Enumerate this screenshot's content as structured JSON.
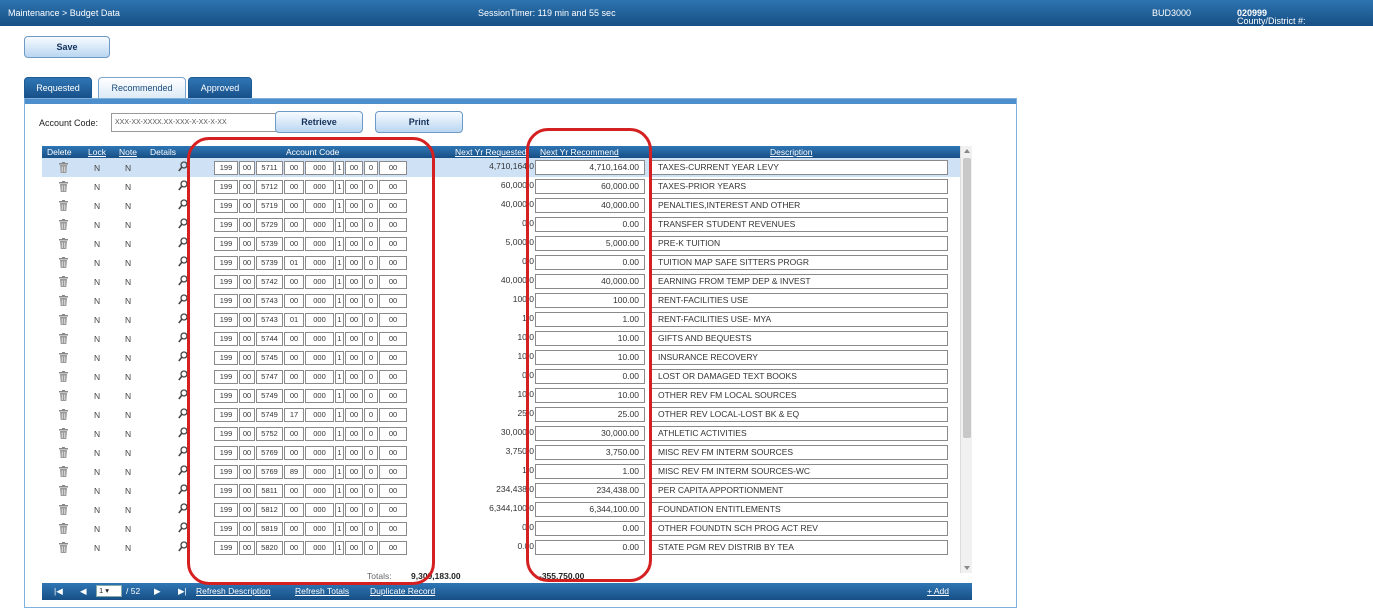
{
  "topbar": {
    "breadcrumb": "Maintenance > Budget Data",
    "session_timer": "SessionTimer: 119 min and 55 sec",
    "page_code": "BUD3000",
    "county_label": "County/District #:",
    "county_value": "020999"
  },
  "toolbar": {
    "save_label": "Save"
  },
  "tabs": [
    {
      "label": "Requested",
      "active": false
    },
    {
      "label": "Recommended",
      "active": true
    },
    {
      "label": "Approved",
      "active": false
    }
  ],
  "search": {
    "label": "Account Code:",
    "value": "XXX-XX-XXXX.XX-XXX-X-XX-X-XX",
    "retrieve_label": "Retrieve",
    "print_label": "Print"
  },
  "grid": {
    "headers": {
      "delete": "Delete",
      "lock": "Lock",
      "note": "Note",
      "details": "Details",
      "account_code": "Account Code",
      "next_yr_requested": "Next Yr Requested",
      "next_yr_recommend": "Next Yr Recommend",
      "description": "Description"
    },
    "rows": [
      {
        "lock": "N",
        "note": "N",
        "code": [
          "199",
          "00",
          "5711",
          "00",
          "000",
          "1",
          "00",
          "0",
          "00"
        ],
        "requested": "4,710,164.0",
        "recommend": "4,710,164.00",
        "description": "TAXES-CURRENT YEAR LEVY"
      },
      {
        "lock": "N",
        "note": "N",
        "code": [
          "199",
          "00",
          "5712",
          "00",
          "000",
          "1",
          "00",
          "0",
          "00"
        ],
        "requested": "60,000.0",
        "recommend": "60,000.00",
        "description": "TAXES-PRIOR YEARS"
      },
      {
        "lock": "N",
        "note": "N",
        "code": [
          "199",
          "00",
          "5719",
          "00",
          "000",
          "1",
          "00",
          "0",
          "00"
        ],
        "requested": "40,000.0",
        "recommend": "40,000.00",
        "description": "PENALTIES,INTEREST AND OTHER"
      },
      {
        "lock": "N",
        "note": "N",
        "code": [
          "199",
          "00",
          "5729",
          "00",
          "000",
          "1",
          "00",
          "0",
          "00"
        ],
        "requested": "0.0",
        "recommend": "0.00",
        "description": "TRANSFER STUDENT REVENUES"
      },
      {
        "lock": "N",
        "note": "N",
        "code": [
          "199",
          "00",
          "5739",
          "00",
          "000",
          "1",
          "00",
          "0",
          "00"
        ],
        "requested": "5,000.0",
        "recommend": "5,000.00",
        "description": "PRE-K TUITION"
      },
      {
        "lock": "N",
        "note": "N",
        "code": [
          "199",
          "00",
          "5739",
          "01",
          "000",
          "1",
          "00",
          "0",
          "00"
        ],
        "requested": "0.0",
        "recommend": "0.00",
        "description": "TUITION MAP SAFE SITTERS PROGR"
      },
      {
        "lock": "N",
        "note": "N",
        "code": [
          "199",
          "00",
          "5742",
          "00",
          "000",
          "1",
          "00",
          "0",
          "00"
        ],
        "requested": "40,000.0",
        "recommend": "40,000.00",
        "description": "EARNING FROM TEMP DEP & INVEST"
      },
      {
        "lock": "N",
        "note": "N",
        "code": [
          "199",
          "00",
          "5743",
          "00",
          "000",
          "1",
          "00",
          "0",
          "00"
        ],
        "requested": "100.0",
        "recommend": "100.00",
        "description": "RENT-FACILITIES USE"
      },
      {
        "lock": "N",
        "note": "N",
        "code": [
          "199",
          "00",
          "5743",
          "01",
          "000",
          "1",
          "00",
          "0",
          "00"
        ],
        "requested": "1.0",
        "recommend": "1.00",
        "description": "RENT-FACILITIES USE- MYA"
      },
      {
        "lock": "N",
        "note": "N",
        "code": [
          "199",
          "00",
          "5744",
          "00",
          "000",
          "1",
          "00",
          "0",
          "00"
        ],
        "requested": "10.0",
        "recommend": "10.00",
        "description": "GIFTS AND BEQUESTS"
      },
      {
        "lock": "N",
        "note": "N",
        "code": [
          "199",
          "00",
          "5745",
          "00",
          "000",
          "1",
          "00",
          "0",
          "00"
        ],
        "requested": "10.0",
        "recommend": "10.00",
        "description": "INSURANCE RECOVERY"
      },
      {
        "lock": "N",
        "note": "N",
        "code": [
          "199",
          "00",
          "5747",
          "00",
          "000",
          "1",
          "00",
          "0",
          "00"
        ],
        "requested": "0.0",
        "recommend": "0.00",
        "description": "LOST OR DAMAGED TEXT BOOKS"
      },
      {
        "lock": "N",
        "note": "N",
        "code": [
          "199",
          "00",
          "5749",
          "00",
          "000",
          "1",
          "00",
          "0",
          "00"
        ],
        "requested": "10.0",
        "recommend": "10.00",
        "description": "OTHER REV FM LOCAL SOURCES"
      },
      {
        "lock": "N",
        "note": "N",
        "code": [
          "199",
          "00",
          "5749",
          "17",
          "000",
          "1",
          "00",
          "0",
          "00"
        ],
        "requested": "25.0",
        "recommend": "25.00",
        "description": "OTHER REV LOCAL-LOST BK & EQ"
      },
      {
        "lock": "N",
        "note": "N",
        "code": [
          "199",
          "00",
          "5752",
          "00",
          "000",
          "1",
          "00",
          "0",
          "00"
        ],
        "requested": "30,000.0",
        "recommend": "30,000.00",
        "description": "ATHLETIC ACTIVITIES"
      },
      {
        "lock": "N",
        "note": "N",
        "code": [
          "199",
          "00",
          "5769",
          "00",
          "000",
          "1",
          "00",
          "0",
          "00"
        ],
        "requested": "3,750.0",
        "recommend": "3,750.00",
        "description": "MISC REV FM INTERM SOURCES"
      },
      {
        "lock": "N",
        "note": "N",
        "code": [
          "199",
          "00",
          "5769",
          "89",
          "000",
          "1",
          "00",
          "0",
          "00"
        ],
        "requested": "1.0",
        "recommend": "1.00",
        "description": "MISC REV FM INTERM SOURCES-WC"
      },
      {
        "lock": "N",
        "note": "N",
        "code": [
          "199",
          "00",
          "5811",
          "00",
          "000",
          "1",
          "00",
          "0",
          "00"
        ],
        "requested": "234,438.0",
        "recommend": "234,438.00",
        "description": "PER CAPITA APPORTIONMENT"
      },
      {
        "lock": "N",
        "note": "N",
        "code": [
          "199",
          "00",
          "5812",
          "00",
          "000",
          "1",
          "00",
          "0",
          "00"
        ],
        "requested": "6,344,100.0",
        "recommend": "6,344,100.00",
        "description": "FOUNDATION ENTITLEMENTS"
      },
      {
        "lock": "N",
        "note": "N",
        "code": [
          "199",
          "00",
          "5819",
          "00",
          "000",
          "1",
          "00",
          "0",
          "00"
        ],
        "requested": "0.0",
        "recommend": "0.00",
        "description": "OTHER FOUNDTN SCH PROG ACT REV"
      },
      {
        "lock": "N",
        "note": "N",
        "code": [
          "199",
          "00",
          "5820",
          "00",
          "000",
          "1",
          "00",
          "0",
          "00"
        ],
        "requested": "0.00",
        "recommend": "0.00",
        "description": "STATE PGM REV DISTRIB BY TEA"
      }
    ]
  },
  "totals": {
    "label": "Totals:",
    "requested": "9,309,183.00",
    "recommend": "-355,750.00"
  },
  "footer": {
    "page": "1",
    "page_of": "/ 52",
    "refresh_description": "Refresh Description",
    "refresh_totals": "Refresh Totals",
    "duplicate_record": "Duplicate Record",
    "add": "+ Add"
  },
  "colors": {
    "header_blue": "#174f85",
    "highlight_ring": "#d42020",
    "selected_row": "#cfe2f5"
  }
}
